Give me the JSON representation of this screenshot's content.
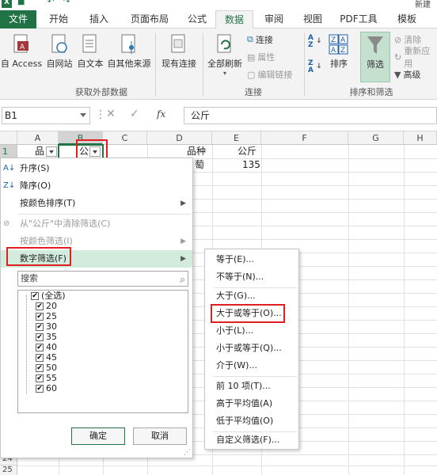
{
  "title": "新建",
  "tabs": [
    "文件",
    "开始",
    "插入",
    "页面布局",
    "公式",
    "数据",
    "审阅",
    "视图",
    "PDF工具",
    "模板"
  ],
  "ribbon": {
    "get_external": {
      "buttons": [
        "自 Access",
        "自网站",
        "自文本",
        "自其他来源"
      ],
      "existing": "现有连接",
      "group_label": "获取外部数据"
    },
    "connections": {
      "refresh_all": "全部刷新",
      "items": [
        "连接",
        "属性",
        "编辑链接"
      ],
      "group_label": "连接"
    },
    "sort_filter": {
      "sort": "排序",
      "filter": "筛选",
      "items": [
        "清除",
        "重新应用",
        "高级"
      ],
      "group_label": "排序和筛选"
    }
  },
  "formula_bar": {
    "name_box": "B1",
    "fx": "fx",
    "formula": "公斤"
  },
  "columns": [
    "A",
    "B",
    "C",
    "D",
    "E",
    "F",
    "G",
    "H"
  ],
  "rows": [
    "1",
    "2",
    "24",
    "25"
  ],
  "cells": {
    "a1": "品",
    "b1": "公",
    "d1": "品种",
    "e1": "公斤",
    "d2": "萄",
    "e2": "135"
  },
  "dropdown": {
    "items": [
      "升序(S)",
      "降序(O)",
      "按颜色排序(T)",
      "从\"公斤\"中清除筛选(C)",
      "按颜色筛选(I)",
      "数字筛选(F)"
    ],
    "search_placeholder": "搜索",
    "list": [
      "(全选)",
      "20",
      "25",
      "30",
      "35",
      "40",
      "45",
      "50",
      "55",
      "60"
    ],
    "ok": "确定",
    "cancel": "取消"
  },
  "submenu": {
    "items": [
      "等于(E)...",
      "不等于(N)...",
      "大于(G)...",
      "大于或等于(O)...",
      "小于(L)...",
      "小于或等于(Q)...",
      "介于(W)...",
      "前 10 项(T)...",
      "高于平均值(A)",
      "低于平均值(O)",
      "自定义筛选(F)..."
    ]
  },
  "colors": {
    "excel_green": "#217346",
    "highlight": "#d3ebdc",
    "red_box": "#e02020"
  }
}
